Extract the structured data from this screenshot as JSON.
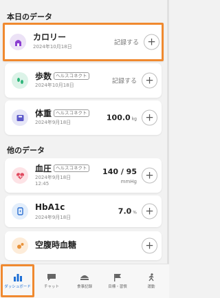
{
  "sections": {
    "today_title": "本日のデータ",
    "other_title": "他のデータ"
  },
  "cards": {
    "calorie": {
      "title": "カロリー",
      "date": "2024年10月18日",
      "action": "記録する"
    },
    "steps": {
      "title": "歩数",
      "tag": "ヘルスコネクト",
      "date": "2024年10月18日",
      "action": "記録する"
    },
    "weight": {
      "title": "体重",
      "tag": "ヘルスコネクト",
      "date": "2024年9月18日",
      "value": "100.0",
      "unit": "kg"
    },
    "bp": {
      "title": "血圧",
      "tag": "ヘルスコネクト",
      "date": "2024年9月18日",
      "time": "12:45",
      "value": "140 / 95",
      "unit": "mmHg"
    },
    "hba1c": {
      "title": "HbA1c",
      "date": "2024年9月18日",
      "value": "7.0",
      "unit": "%"
    },
    "glucose": {
      "title": "空腹時血糖"
    }
  },
  "plus_label": "+",
  "tabs": [
    {
      "label": "ダッシュボード",
      "icon": "bar-chart-icon"
    },
    {
      "label": "チャット",
      "icon": "chat-icon"
    },
    {
      "label": "食事記録",
      "icon": "meal-icon"
    },
    {
      "label": "目標・習慣",
      "icon": "flag-icon"
    },
    {
      "label": "運動",
      "icon": "exercise-icon"
    }
  ],
  "colors": {
    "highlight": "#f0892f",
    "active_tab": "#1d6fd6",
    "calorie_icon_bg": "#ece2f6",
    "calorie_icon": "#8c3fd1",
    "steps_icon_bg": "#dcf3e8",
    "steps_icon": "#2fb57a",
    "weight_icon_bg": "#e6e6f7",
    "weight_icon": "#5b57c9",
    "bp_icon_bg": "#fde3e6",
    "bp_icon": "#e04a5f",
    "hba1c_icon_bg": "#e3eefb",
    "hba1c_icon": "#2b6fd1",
    "glucose_icon_bg": "#fdecd9",
    "glucose_icon": "#e8923a"
  }
}
